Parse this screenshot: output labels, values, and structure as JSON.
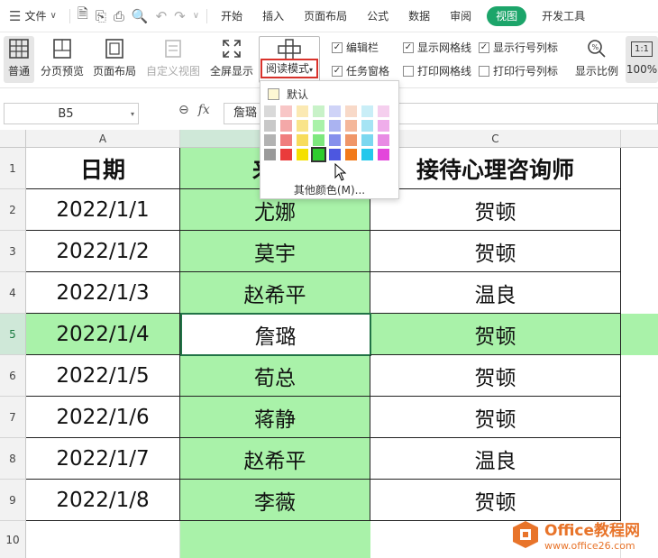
{
  "menubar": {
    "file_label": "文件",
    "tabs": [
      "开始",
      "插入",
      "页面布局",
      "公式",
      "数据",
      "审阅",
      "视图",
      "开发工具"
    ],
    "active_tab": "视图"
  },
  "ribbon": {
    "normal": "普通",
    "page_break_preview": "分页预览",
    "page_layout": "页面布局",
    "custom_view": "自定义视图",
    "full_screen": "全屏显示",
    "reading_mode": "阅读模式",
    "edit_bar": "编辑栏",
    "task_pane": "任务窗格",
    "show_gridlines": "显示网格线",
    "print_gridlines": "打印网格线",
    "show_row_col_headers": "显示行号列标",
    "print_row_col_headers": "打印行号列标",
    "zoom_label": "显示比例",
    "zoom_value": "100%",
    "one_to_one": "1:1",
    "checks": {
      "edit_bar": true,
      "task_pane": true,
      "show_gridlines": true,
      "print_gridlines": false,
      "show_row_col_headers": true,
      "print_row_col_headers": false
    }
  },
  "formula_bar": {
    "name_box": "B5",
    "fx": "fx",
    "content": "詹璐"
  },
  "dropdown": {
    "default_label": "默认",
    "more_colors": "其他颜色(M)...",
    "palette": [
      "#d9d9d9",
      "#f8c6c6",
      "#fbe9b3",
      "#c8f2c8",
      "#cfd3f7",
      "#f8d9c8",
      "#c9eef7",
      "#f5cfee",
      "#c8c8c8",
      "#f4a8a8",
      "#f9e48a",
      "#a9f2a9",
      "#aab3f1",
      "#f4b79a",
      "#a6e4f4",
      "#efadea",
      "#b3b3b3",
      "#f07e7e",
      "#f7dc5c",
      "#7ee87e",
      "#8690ec",
      "#f09668",
      "#7bd8f0",
      "#e88be4",
      "#9a9a9a",
      "#ea3b3b",
      "#f5e000",
      "#2ecc2e",
      "#4d57e0",
      "#f27a1a",
      "#23c8ec",
      "#e346db"
    ],
    "picked_index": 27
  },
  "sheet": {
    "columns": [
      "A",
      "B",
      "C"
    ],
    "rows": [
      "1",
      "2",
      "3",
      "4",
      "5",
      "6",
      "7",
      "8",
      "9",
      "10"
    ],
    "header": [
      "日期",
      "来访",
      "接待心理咨询师"
    ],
    "data": [
      [
        "2022/1/1",
        "尤娜",
        "贺顿"
      ],
      [
        "2022/1/2",
        "莫宇",
        "贺顿"
      ],
      [
        "2022/1/3",
        "赵希平",
        "温良"
      ],
      [
        "2022/1/4",
        "詹璐",
        "贺顿"
      ],
      [
        "2022/1/5",
        "荀总",
        "贺顿"
      ],
      [
        "2022/1/6",
        "蒋静",
        "贺顿"
      ],
      [
        "2022/1/7",
        "赵希平",
        "温良"
      ],
      [
        "2022/1/8",
        "李薇",
        "贺顿"
      ]
    ],
    "active_cell": "B5"
  },
  "watermark": {
    "title": "Office教程网",
    "url": "www.office26.com"
  }
}
